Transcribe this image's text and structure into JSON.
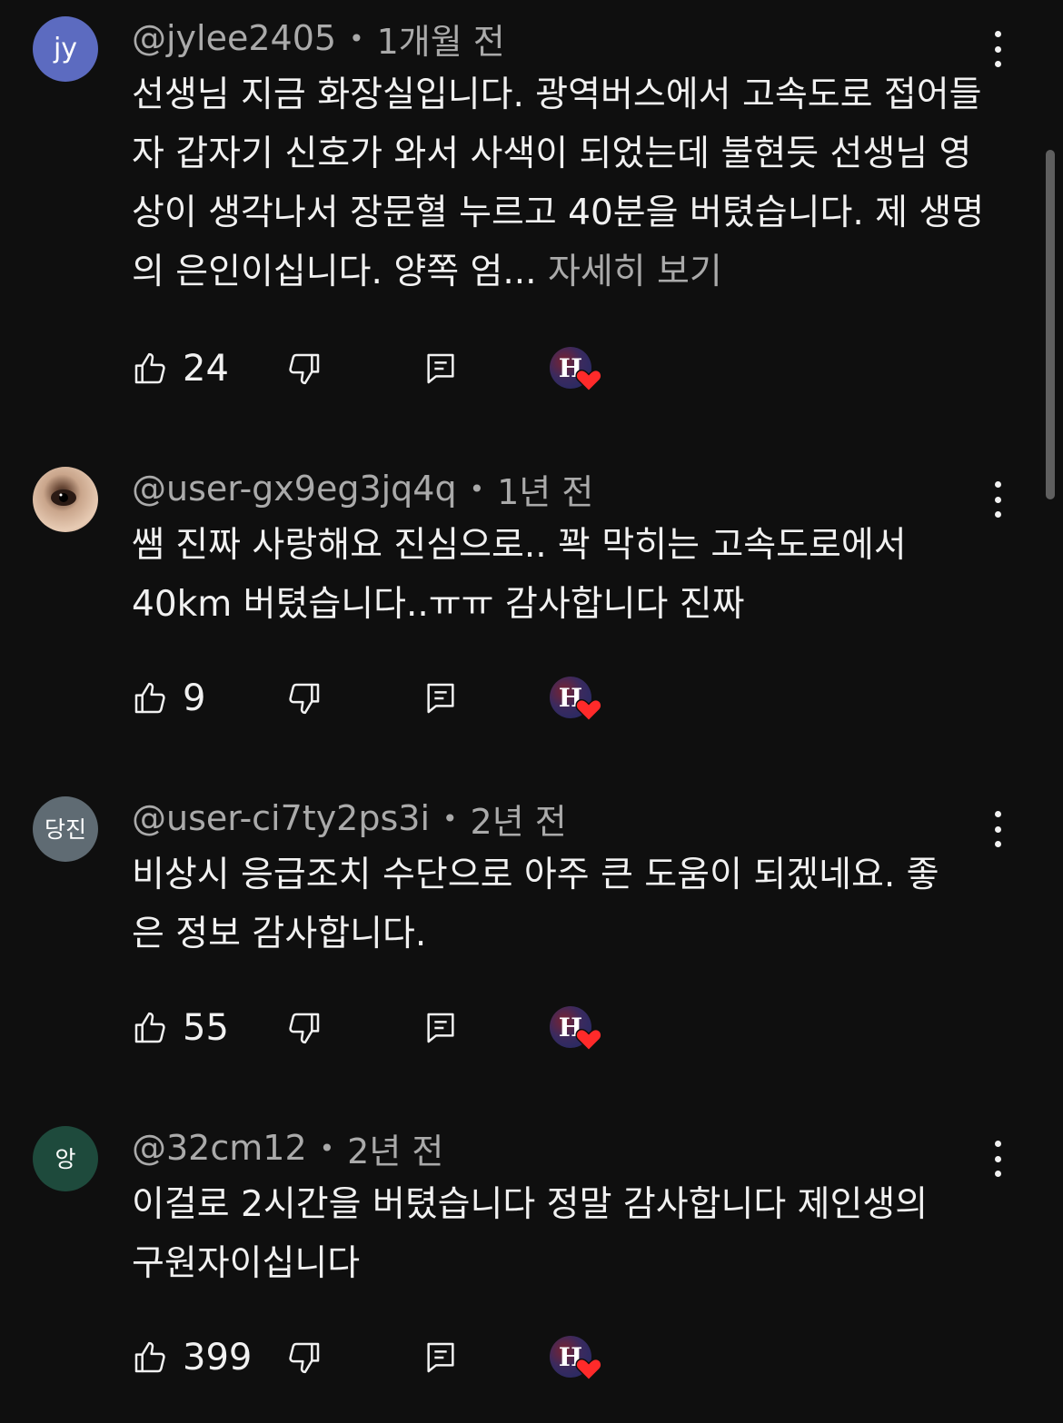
{
  "comments": [
    {
      "avatar_text": "jy",
      "avatar_color": "#5c6bc0",
      "handle": "@jylee2405",
      "time": "1개월 전",
      "text": "선생님 지금 화장실입니다. 광역버스에서 고속도로 접어들자 갑자기 신호가 와서 사색이 되었는데 불현듯 선생님 영상이 생각나서 장문혈 누르고 40분을 버텼습니다. 제 생명의 은인이십니다. 양쪽 엄...",
      "more_label": "자세히 보기",
      "likes": "24"
    },
    {
      "avatar_text": "",
      "avatar_color": "#c9a58b",
      "handle": "@user-gx9eg3jq4q",
      "time": "1년 전",
      "text": "쌤 진짜 사랑해요 진심으로.. 꽉 막히는 고속도로에서 40km 버텼습니다..ㅠㅠ 감사합니다 진짜",
      "more_label": "",
      "likes": "9"
    },
    {
      "avatar_text": "당진",
      "avatar_color": "#5f6b73",
      "handle": "@user-ci7ty2ps3i",
      "time": "2년 전",
      "text": "비상시 응급조치 수단으로 아주 큰 도움이 되겠네요. 좋은 정보 감사합니다.",
      "more_label": "",
      "likes": "55"
    },
    {
      "avatar_text": "앙",
      "avatar_color": "#1e4a3c",
      "handle": "@32cm12",
      "time": "2년 전",
      "text": "이걸로 2시간을 버텼습니다 정말 감사합니다 제인생의 구원자이십니다",
      "more_label": "",
      "likes": "399"
    }
  ],
  "icons": {
    "like": "thumb-up-icon",
    "dislike": "thumb-down-icon",
    "reply": "comment-icon",
    "more": "more-vert-icon",
    "creator_heart": "creator-heart-icon"
  },
  "creator_badge_letter": "H",
  "heart_color": "#ff2a2a",
  "background_color": "#0f0f0f"
}
